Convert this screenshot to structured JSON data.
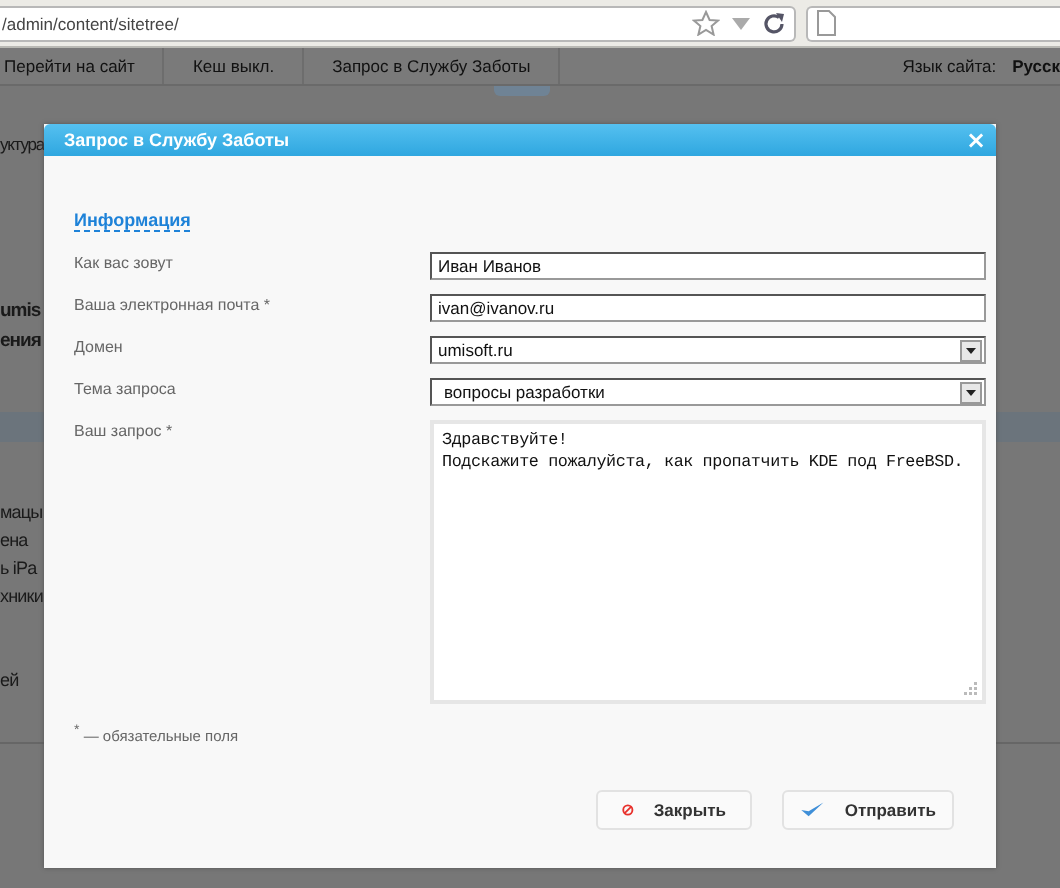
{
  "browser": {
    "url": "/admin/content/sitetree/"
  },
  "nav": {
    "items": [
      "Перейти на сайт",
      "Кеш выкл.",
      "Запрос в Службу Заботы"
    ],
    "language_label": "Язык сайта:",
    "language_value": "Русск"
  },
  "background_texts": [
    {
      "text": "уктура",
      "kind": "plain"
    },
    {
      "text": "umis",
      "kind": "heading"
    },
    {
      "text": "ения",
      "kind": "heading"
    },
    {
      "kind": "band"
    },
    {
      "text": "мацы",
      "kind": "plain"
    },
    {
      "text": "ена",
      "kind": "plain"
    },
    {
      "text": "ь iPa",
      "kind": "plain"
    },
    {
      "text": "хники",
      "kind": "plain"
    },
    {
      "text": "ей",
      "kind": "plain"
    }
  ],
  "dialog": {
    "title": "Запрос в Службу Заботы",
    "close": "×",
    "section_link": "Информация",
    "fields": [
      {
        "label": "Как вас зовут",
        "kind": "text",
        "value": "Иван Иванов"
      },
      {
        "label": "Ваша электронная почта *",
        "kind": "text",
        "value": "ivan@ivanov.ru"
      },
      {
        "label": "Домен",
        "kind": "select",
        "value": "umisoft.ru"
      },
      {
        "label": "Тема запроса",
        "kind": "select",
        "value": "вопросы разработки"
      },
      {
        "label": "Ваш запрос *",
        "kind": "textarea",
        "value": "Здравствуйте!\nПодскажите пожалуйста, как пропатчить KDE под FreeBSD."
      }
    ],
    "required_note": "$^{*}$ — обязательные поля",
    "buttons": [
      {
        "label": "Закрыть",
        "kind": "cancel"
      },
      {
        "label": "Отправить",
        "kind": "submit"
      }
    ]
  }
}
